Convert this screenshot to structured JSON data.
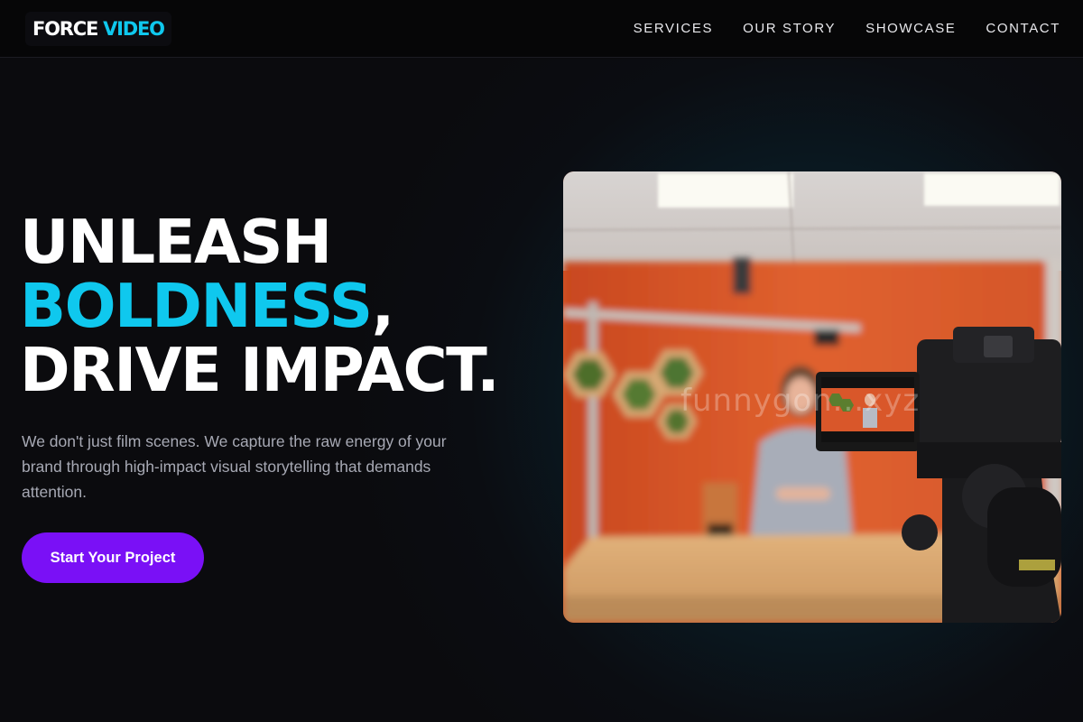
{
  "brand": {
    "part1": "FORCE",
    "part2": "VIDEO",
    "accent_color": "#0fc8ee"
  },
  "nav": {
    "items": [
      {
        "label": "SERVICES"
      },
      {
        "label": "OUR STORY"
      },
      {
        "label": "SHOWCASE"
      },
      {
        "label": "CONTACT"
      }
    ]
  },
  "hero": {
    "headline": {
      "line1": "UNLEASH",
      "accent": "BOLDNESS",
      "comma": ",",
      "line3": "DRIVE IMPACT."
    },
    "description": "We don't just film scenes. We capture the raw energy of your brand through high-impact visual storytelling that demands attention.",
    "cta_label": "Start Your Project",
    "cta_color": "#7a10f6",
    "image": {
      "subject": "video-shoot-photo",
      "watermark": "funnygon...xyz"
    }
  }
}
